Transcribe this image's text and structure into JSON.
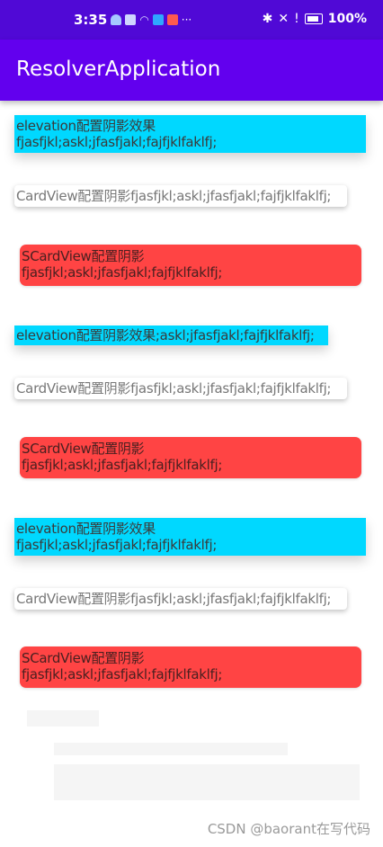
{
  "status_bar": {
    "time": "3:35",
    "more": "···",
    "battery_percent": "100%"
  },
  "app_bar": {
    "title": "ResolverApplication"
  },
  "blocks": [
    {
      "kind": "elevation",
      "lines": [
        "elevation配置阴影效果",
        "fjasfjkl;askl;jfasfjakl;fajfjklfaklfj;"
      ]
    },
    {
      "kind": "cardview",
      "lines": [
        "CardView配置阴影fjasfjkl;askl;jfasfjakl;fajfjklfaklfj;"
      ]
    },
    {
      "kind": "scardview",
      "lines": [
        "SCardView配置阴影",
        "fjasfjkl;askl;jfasfjakl;fajfjklfaklfj;"
      ]
    },
    {
      "kind": "elevation",
      "lines": [
        "elevation配置阴影效果;askl;jfasfjakl;fajfjklfaklfj;"
      ]
    },
    {
      "kind": "cardview",
      "lines": [
        "CardView配置阴影fjasfjkl;askl;jfasfjakl;fajfjklfaklfj;"
      ]
    },
    {
      "kind": "scardview",
      "lines": [
        "SCardView配置阴影",
        "fjasfjkl;askl;jfasfjakl;fajfjklfaklfj;"
      ]
    },
    {
      "kind": "elevation",
      "lines": [
        "elevation配置阴影效果",
        "fjasfjkl;askl;jfasfjakl;fajfjklfaklfj;"
      ]
    },
    {
      "kind": "cardview",
      "lines": [
        "CardView配置阴影fjasfjkl;askl;jfasfjakl;fajfjklfaklfj;"
      ]
    },
    {
      "kind": "scardview",
      "lines": [
        "SCardView配置阴影",
        "fjasfjkl;askl;jfasfjakl;fajfjklfaklfj;"
      ]
    }
  ],
  "watermark": "CSDN @baorant在写代码",
  "colors": {
    "status_bar": "#5009d6",
    "app_bar": "#6200ee",
    "elevation_bg": "#00d8ff",
    "scard_bg": "#ff4444",
    "card_bg": "#ffffff"
  }
}
